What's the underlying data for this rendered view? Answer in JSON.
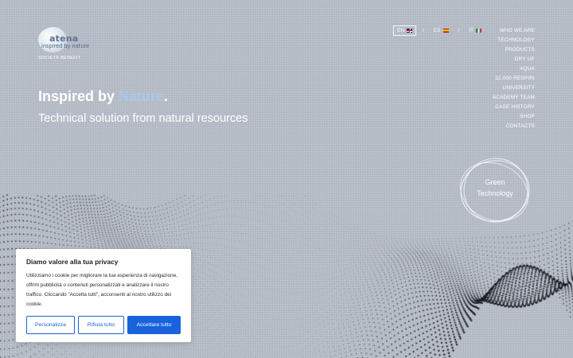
{
  "brand": {
    "name": "atena",
    "tagline": "inspired by nature",
    "subtitle": "SOCIETÀ BENEFIT"
  },
  "languages": [
    {
      "code": "EN",
      "flag": "uk-flag-icon",
      "active": true
    },
    {
      "code": "ES",
      "flag": "spain-flag-icon",
      "active": false
    },
    {
      "code": "IT",
      "flag": "italy-flag-icon",
      "active": false
    }
  ],
  "language_separator": "/",
  "nav": [
    "WHO WE ARE",
    "TECHNOLOGY",
    "PRODUCTS",
    "DRY UP",
    "AQUA",
    "22.000 RESPIRI",
    "UNIVERSITY",
    "ACADEMY TEAM",
    "CASE HISTORY",
    "SHOP",
    "CONTACTS"
  ],
  "hero": {
    "title_prefix": "Inspired by ",
    "title_accent": "Nature",
    "title_suffix": ".",
    "subtitle": "Technical solution from natural resources"
  },
  "badge": {
    "line1": "Green",
    "line2": "Technology"
  },
  "cookie": {
    "title": "Diamo valore alla tua privacy",
    "text": "Utilizziamo i cookie per migliorare la tua esperienza di navigazione, offrirti pubblicità o contenuti personalizzati e analizzare il nostro traffico. Cliccando “Accetta tutti”, acconsenti al nostro utilizzo dei cookie.",
    "buttons": {
      "customize": "Personalizza",
      "reject": "Rifiuta tutto",
      "accept": "Accettare tutto"
    }
  },
  "colors": {
    "background": "#b3b9c4",
    "accent": "#a9c7e9",
    "primary_button": "#1863dc"
  }
}
